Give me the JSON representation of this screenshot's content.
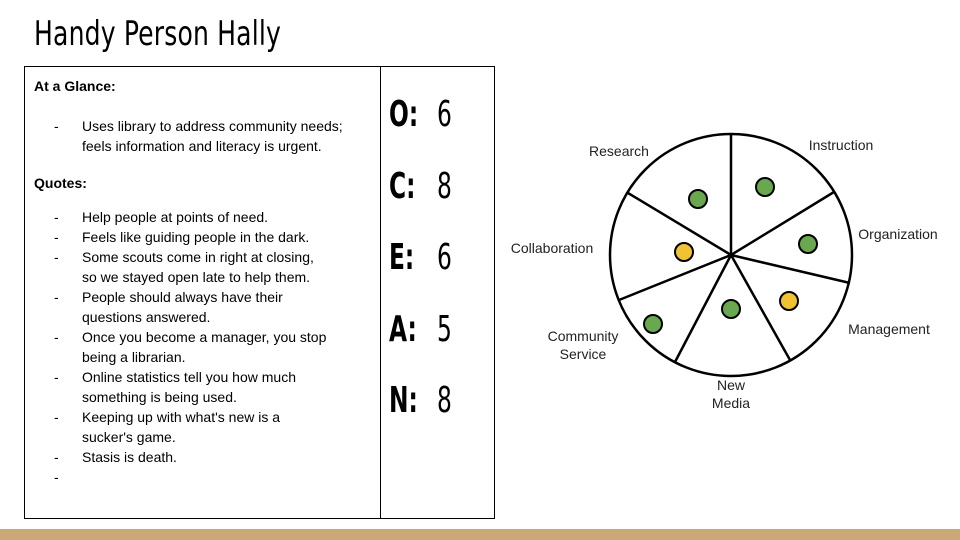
{
  "title": "Handy Person Hally",
  "at_a_glance": {
    "heading": "At a Glance:",
    "items": [
      "Uses library to address community needs; feels information and literacy is urgent."
    ]
  },
  "quotes": {
    "heading": "Quotes:",
    "items": [
      "Help people at points of need.",
      "Feels like guiding people in the dark.",
      "Some scouts come in right at closing, so we stayed open late to help them.",
      "People should always have their questions answered.",
      "Once you become a manager, you stop being a librarian.",
      "Online statistics tell you how much something is being used.",
      "Keeping up with what's new is a sucker's game.",
      "Stasis is death.",
      ""
    ]
  },
  "ocean_scores": [
    {
      "letter": "O:",
      "score": "6"
    },
    {
      "letter": "C:",
      "score": "8"
    },
    {
      "letter": "E:",
      "score": "6"
    },
    {
      "letter": "A:",
      "score": "5"
    },
    {
      "letter": "N:",
      "score": "8"
    }
  ],
  "wheel": {
    "segments": [
      {
        "label": "Instruction",
        "dot_color": "#6aa84f"
      },
      {
        "label": "Organization",
        "dot_color": "#6aa84f"
      },
      {
        "label": "Management",
        "dot_color": "#f1c232"
      },
      {
        "label": "New Media",
        "label_lines": [
          "New",
          "Media"
        ],
        "dot_color": "#6aa84f"
      },
      {
        "label": "Community Service",
        "label_lines": [
          "Community",
          "Service"
        ],
        "dot_color": "#6aa84f"
      },
      {
        "label": "Collaboration",
        "dot_color": "#f1c232"
      },
      {
        "label": "Research",
        "dot_color": "#6aa84f"
      }
    ]
  },
  "colors": {
    "green_dot": "#6aa84f",
    "yellow_dot": "#f1c232",
    "bottom_bar": "#cba77a"
  }
}
